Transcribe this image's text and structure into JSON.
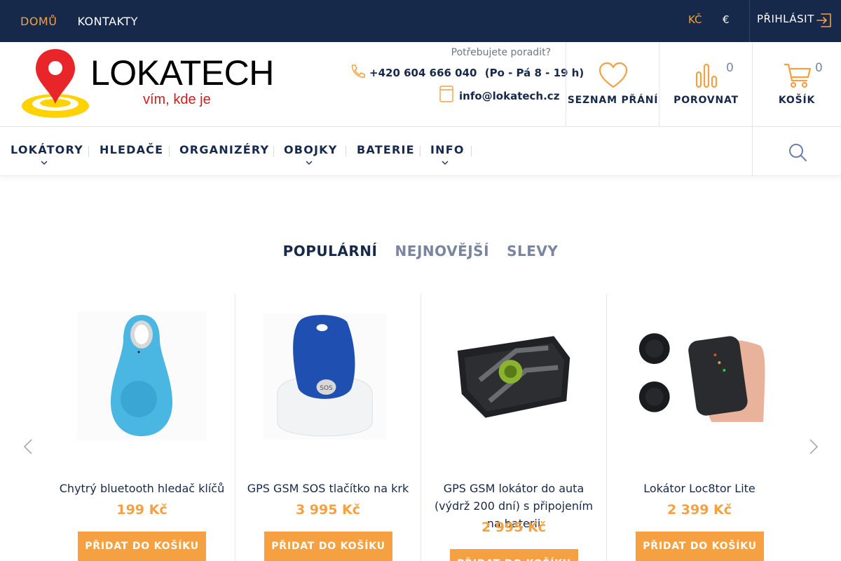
{
  "topbar": {
    "links": [
      "DOMŮ",
      "KONTAKTY"
    ],
    "currency_primary": "KČ",
    "currency_secondary": "€",
    "login": "PŘIHLÁSIT"
  },
  "logo": {
    "name": "LOKATECH",
    "tagline": "vím, kde je"
  },
  "contact": {
    "advise": "Potřebujete poradit?",
    "phone": "+420 604 666 040",
    "hours": "(Po - Pá 8 - 19 h)",
    "email": "info@lokatech.cz"
  },
  "header_actions": {
    "wishlist": "SEZNAM PŘÁNÍ",
    "compare": "POROVNAT",
    "compare_count": "0",
    "cart": "KOŠÍK",
    "cart_count": "0"
  },
  "nav": {
    "items": [
      "LOKÁTORY",
      "HLEDAČE",
      "ORGANIZÉRY",
      "OBOJKY",
      "BATERIE",
      "INFO"
    ]
  },
  "tabs": [
    "POPULÁRNÍ",
    "NEJNOVĚJŠÍ",
    "SLEVY"
  ],
  "products": [
    {
      "title": "Chytrý bluetooth hledač klíčů",
      "price": "199 Kč",
      "button": "PŘIDAT DO KOŠÍKU"
    },
    {
      "title": "GPS GSM SOS tlačítko na krk",
      "price": "3 995 Kč",
      "button": "PŘIDAT DO KOŠÍKU"
    },
    {
      "title": "GPS GSM lokátor do auta (výdrž 200 dní) s připojením na baterii",
      "price": "2 995 Kč",
      "button": "PŘIDAT DO KOŠÍKU"
    },
    {
      "title": "Lokátor Loc8tor Lite",
      "price": "2 399 Kč",
      "button": "PŘIDAT DO KOŠÍKU"
    }
  ],
  "colors": {
    "navy": "#17294b",
    "accent": "#f5a142",
    "logo_red": "#e8262a",
    "logo_yellow": "#ffd200"
  }
}
